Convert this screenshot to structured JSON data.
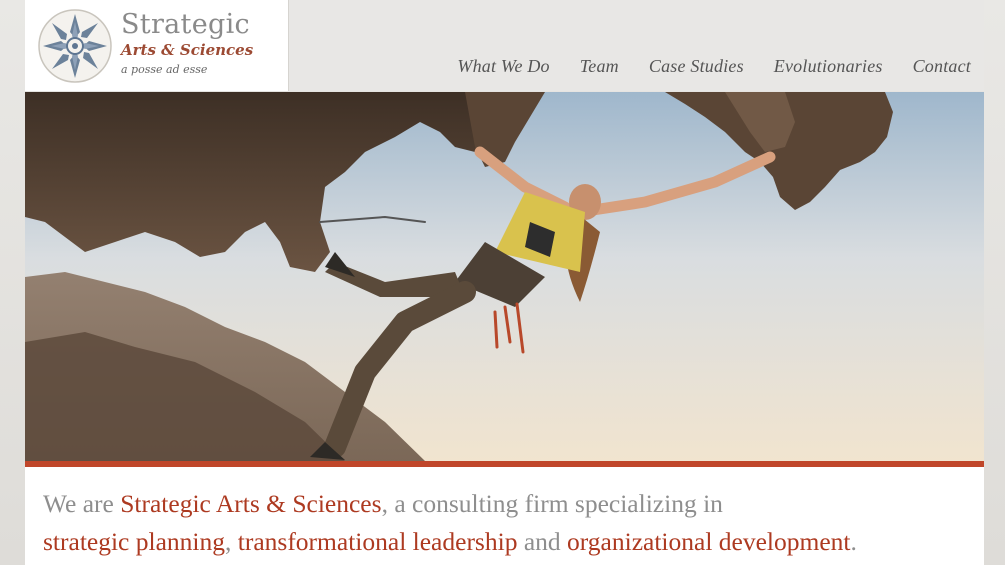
{
  "brand": {
    "name": "Strategic",
    "subname": "Arts & Sciences",
    "tagline": "a posse ad esse"
  },
  "nav": {
    "items": [
      "What We Do",
      "Team",
      "Case Studies",
      "Evolutionaries",
      "Contact"
    ]
  },
  "intro": {
    "lead": "We are ",
    "company": "Strategic Arts & Sciences",
    "mid": ", a consulting firm specializing in",
    "s1": "strategic planning",
    "comma": ", ",
    "s2": "transformational leadership",
    "and": " and ",
    "s3": "organizational development",
    "end": "."
  },
  "colors": {
    "accent": "#c0462a",
    "highlight_text": "#ad3a21",
    "body_text": "#8e8e8e",
    "nav_text": "#555555"
  },
  "hero": {
    "subject": "rock climber hanging from overhang at sunset"
  }
}
